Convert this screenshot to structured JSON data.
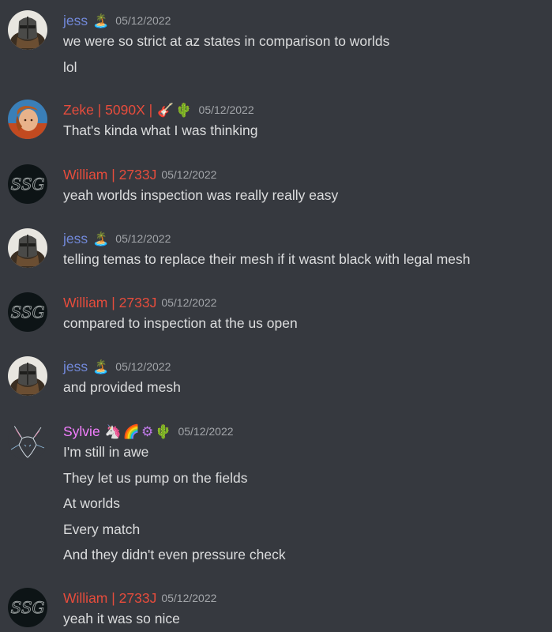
{
  "colors": {
    "background": "#36393f",
    "text": "#dcddde",
    "timestamp": "#a3a6aa",
    "jess": "#7289da",
    "zeke": "#e74c3c",
    "william": "#e74c3c",
    "sylvie": "#f47fff"
  },
  "messages": [
    {
      "author": "jess",
      "badges": [
        "🏝️"
      ],
      "timestamp": "05/12/2022",
      "avatar_icon": "knight-helmet-avatar-icon",
      "lines": [
        "we were so strict at az states in comparison to worlds",
        "lol"
      ]
    },
    {
      "author": "Zeke | 5090X |",
      "badges": [
        "🎸",
        "🌵"
      ],
      "timestamp": "05/12/2022",
      "avatar_icon": "person-photo-avatar-icon",
      "lines": [
        "That's kinda what I was thinking"
      ]
    },
    {
      "author": "William | 2733J",
      "badges": [],
      "timestamp": "05/12/2022",
      "avatar_icon": "ssg-logo-avatar-icon",
      "lines": [
        "yeah worlds inspection was really really easy"
      ]
    },
    {
      "author": "jess",
      "badges": [
        "🏝️"
      ],
      "timestamp": "05/12/2022",
      "avatar_icon": "knight-helmet-avatar-icon",
      "lines": [
        "telling temas to replace their mesh if it wasnt black with legal mesh"
      ]
    },
    {
      "author": "William | 2733J",
      "badges": [],
      "timestamp": "05/12/2022",
      "avatar_icon": "ssg-logo-avatar-icon",
      "lines": [
        "compared to inspection at the us open"
      ]
    },
    {
      "author": "jess",
      "badges": [
        "🏝️"
      ],
      "timestamp": "05/12/2022",
      "avatar_icon": "knight-helmet-avatar-icon",
      "lines": [
        "and provided mesh"
      ]
    },
    {
      "author": "Sylvie",
      "badges": [
        "🦄",
        "🌈",
        "⚙",
        "🌵"
      ],
      "timestamp": "05/12/2022",
      "avatar_icon": "fox-sketch-avatar-icon",
      "lines": [
        "I'm still in awe",
        "They let us pump on the fields",
        "At worlds",
        "Every match",
        "And they didn't even pressure check"
      ]
    },
    {
      "author": "William | 2733J",
      "badges": [],
      "timestamp": "05/12/2022",
      "avatar_icon": "ssg-logo-avatar-icon",
      "lines": [
        "yeah it was so nice"
      ]
    }
  ]
}
